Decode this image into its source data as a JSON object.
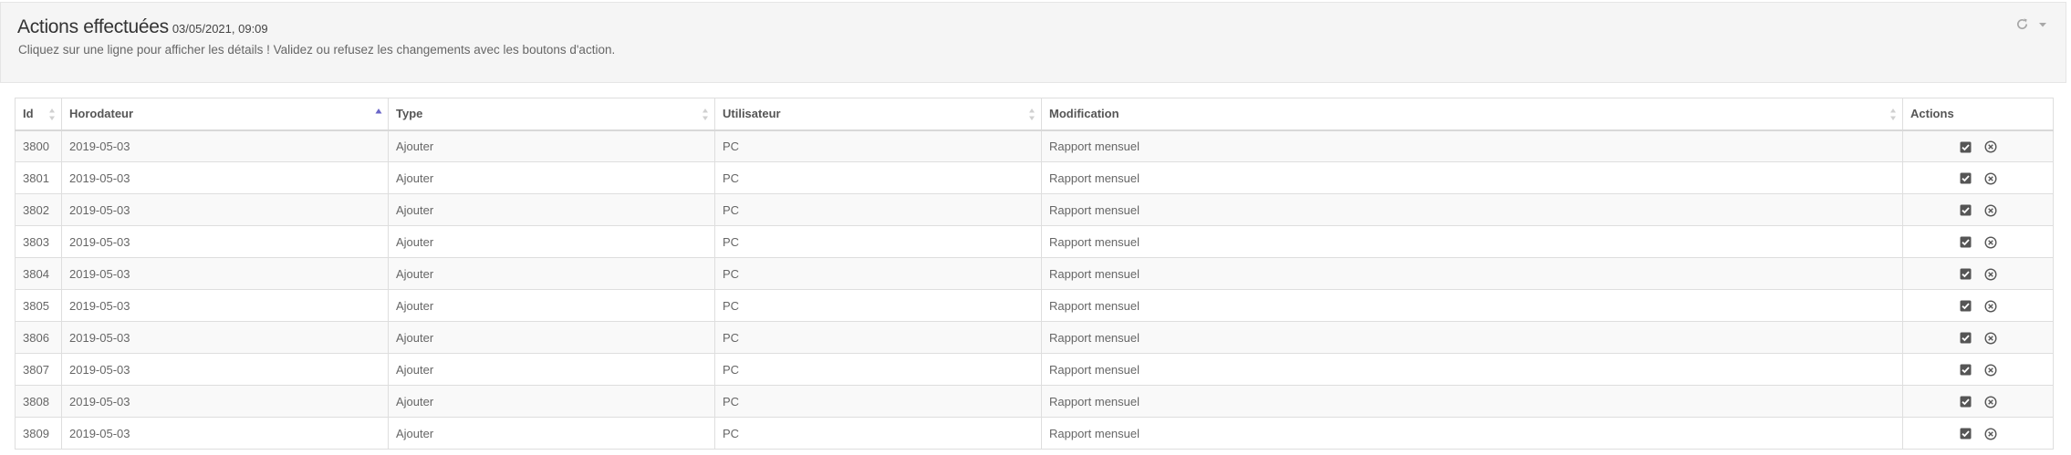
{
  "header": {
    "title": "Actions effectuées",
    "timestamp": "03/05/2021, 09:09",
    "subtitle": "Cliquez sur une ligne pour afficher les détails ! Validez ou refusez les changements avec les boutons d'action.",
    "tools": [
      "refresh-icon",
      "caret-down-icon"
    ]
  },
  "table": {
    "columns": [
      "Id",
      "Horodateur",
      "Type",
      "Utilisateur",
      "Modification",
      "Actions"
    ],
    "sorted_column": "Horodateur",
    "sort_direction": "ascending",
    "rows": [
      {
        "id": "3800",
        "date": "2019-05-03",
        "type": "Ajouter",
        "user": "PC",
        "modification": "Rapport mensuel"
      },
      {
        "id": "3801",
        "date": "2019-05-03",
        "type": "Ajouter",
        "user": "PC",
        "modification": "Rapport mensuel"
      },
      {
        "id": "3802",
        "date": "2019-05-03",
        "type": "Ajouter",
        "user": "PC",
        "modification": "Rapport mensuel"
      },
      {
        "id": "3803",
        "date": "2019-05-03",
        "type": "Ajouter",
        "user": "PC",
        "modification": "Rapport mensuel"
      },
      {
        "id": "3804",
        "date": "2019-05-03",
        "type": "Ajouter",
        "user": "PC",
        "modification": "Rapport mensuel"
      },
      {
        "id": "3805",
        "date": "2019-05-03",
        "type": "Ajouter",
        "user": "PC",
        "modification": "Rapport mensuel"
      },
      {
        "id": "3806",
        "date": "2019-05-03",
        "type": "Ajouter",
        "user": "PC",
        "modification": "Rapport mensuel"
      },
      {
        "id": "3807",
        "date": "2019-05-03",
        "type": "Ajouter",
        "user": "PC",
        "modification": "Rapport mensuel"
      },
      {
        "id": "3808",
        "date": "2019-05-03",
        "type": "Ajouter",
        "user": "PC",
        "modification": "Rapport mensuel"
      },
      {
        "id": "3809",
        "date": "2019-05-03",
        "type": "Ajouter",
        "user": "PC",
        "modification": "Rapport mensuel"
      }
    ],
    "row_actions": [
      "check-square-icon",
      "times-circle-icon"
    ]
  },
  "colors": {
    "panel_bg": "#f5f5f5",
    "sort_active": "#6a66c8",
    "icon": "#555555"
  }
}
